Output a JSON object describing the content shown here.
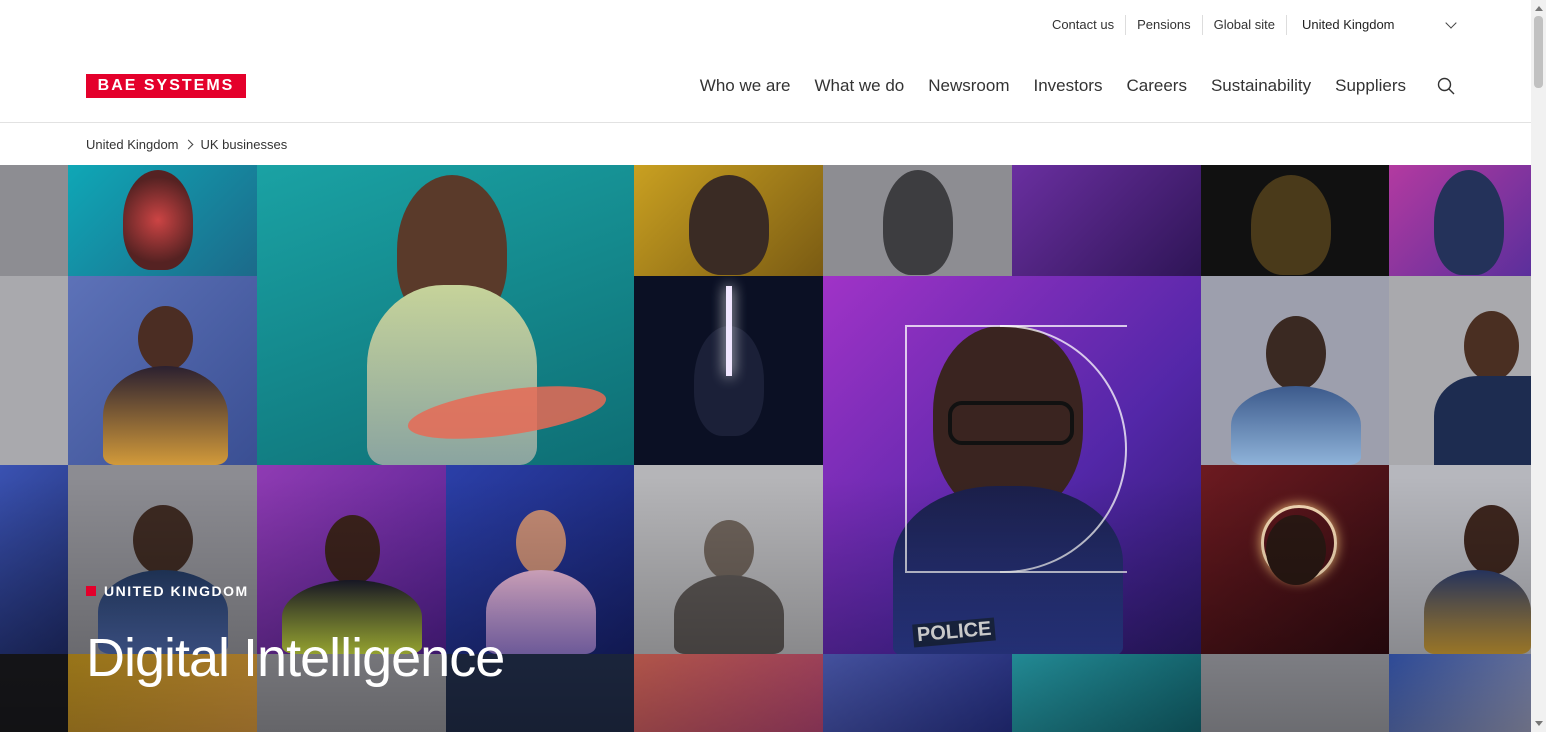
{
  "utility": {
    "links": [
      "Contact us",
      "Pensions",
      "Global site"
    ],
    "region": "United Kingdom"
  },
  "brand": {
    "logo_text": "BAE SYSTEMS",
    "color": "#e4002b"
  },
  "nav": {
    "items": [
      "Who we are",
      "What we do",
      "Newsroom",
      "Investors",
      "Careers",
      "Sustainability",
      "Suppliers"
    ],
    "search_icon": "search-icon"
  },
  "breadcrumb": [
    "United Kingdom",
    "UK businesses"
  ],
  "hero": {
    "tag": "UNITED KINGDOM",
    "title": "Digital Intelligence",
    "tile_caption": "POLICE"
  }
}
